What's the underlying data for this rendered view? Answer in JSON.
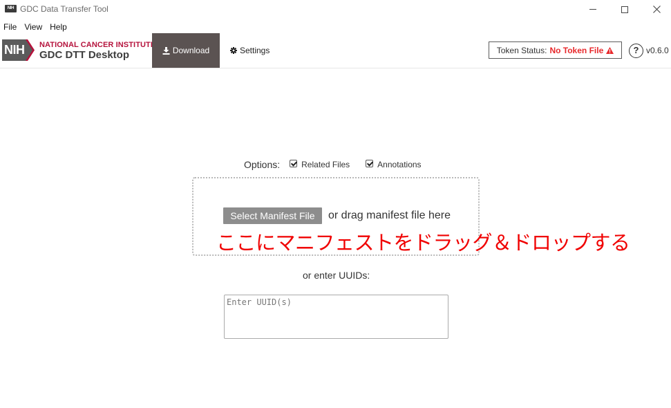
{
  "window": {
    "title": "GDC Data Transfer Tool",
    "icon_text": "NIH",
    "controls": {
      "minimize": "minimize-icon",
      "maximize": "maximize-icon",
      "close": "close-icon"
    }
  },
  "menu": {
    "items": [
      {
        "label": "File"
      },
      {
        "label": "View"
      },
      {
        "label": "Help"
      }
    ]
  },
  "header": {
    "logo": {
      "nih": "NIH",
      "institute": "NATIONAL CANCER INSTITUTE",
      "product": "GDC DTT Desktop"
    },
    "nav": {
      "download": {
        "label": "Download",
        "icon": "download-icon"
      },
      "settings": {
        "label": "Settings",
        "icon": "gear-icon"
      }
    },
    "token": {
      "label": "Token Status:",
      "value": "No Token File",
      "icon": "warning-icon"
    },
    "help_icon_text": "?",
    "version": "v0.6.0"
  },
  "options": {
    "label": "Options:",
    "related_files": {
      "label": "Related Files",
      "checked": true
    },
    "annotations": {
      "label": "Annotations",
      "checked": true
    }
  },
  "dropzone": {
    "select_button": "Select Manifest File",
    "drag_text": "or drag manifest file here",
    "annotation_overlay": "ここにマニフェストをドラッグ＆ドロップする"
  },
  "uuid": {
    "label": "or enter UUIDs:",
    "placeholder": "Enter UUID(s)",
    "value": ""
  },
  "colors": {
    "nav_active_bg": "#5b5352",
    "brand_red": "#b5123c",
    "token_warning": "#e8292c",
    "button_gray": "#8d8d8d",
    "annotation_red": "#f00000"
  }
}
